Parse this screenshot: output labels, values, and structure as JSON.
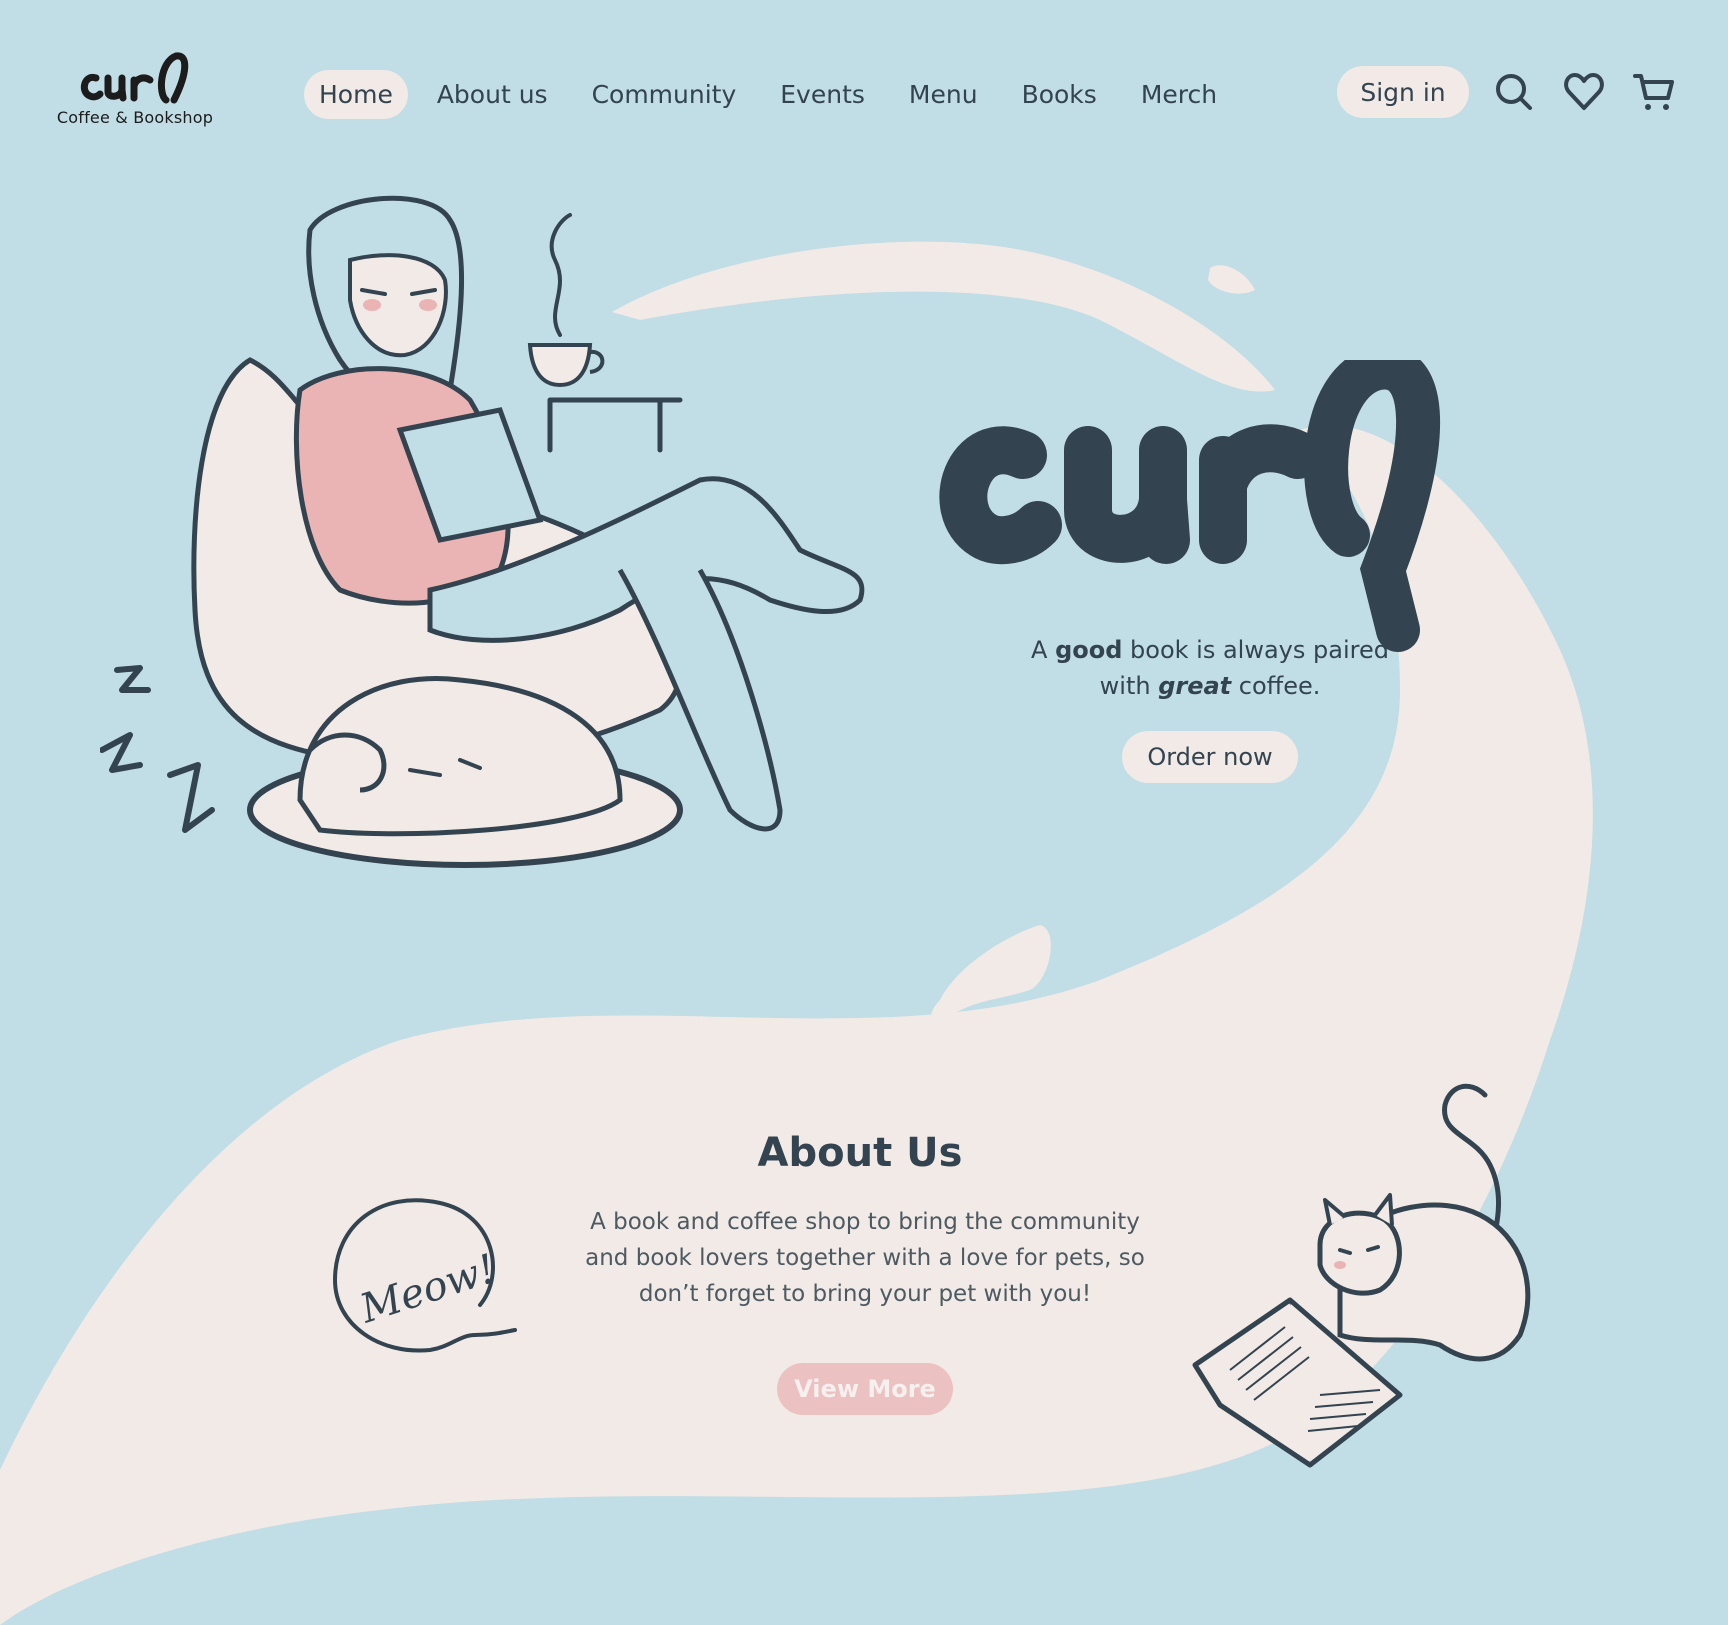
{
  "brand": {
    "name": "curl",
    "subtitle": "Coffee & Bookshop"
  },
  "nav": {
    "items": [
      {
        "label": "Home",
        "active": true
      },
      {
        "label": "About us"
      },
      {
        "label": "Community"
      },
      {
        "label": "Events"
      },
      {
        "label": "Menu"
      },
      {
        "label": "Books"
      },
      {
        "label": "Merch"
      }
    ]
  },
  "header": {
    "sign_in_label": "Sign in",
    "icons": [
      "search-icon",
      "heart-icon",
      "cart-icon"
    ]
  },
  "hero": {
    "title": "curl",
    "tagline_pre": "A ",
    "tagline_bold": "good",
    "tagline_mid": " book is always paired with ",
    "tagline_italic": "great",
    "tagline_post": " coffee.",
    "cta_label": "Order now"
  },
  "about": {
    "title": "About Us",
    "text": "A book and coffee shop to bring the community and book lovers together with a love for pets, so don’t forget to bring your pet with you!",
    "cta_label": "View More",
    "sketch_text": "Meow!"
  },
  "colors": {
    "background": "#c1dde5",
    "cream": "#f1eae6",
    "ink": "#334450",
    "pink": "#ebc1c1"
  }
}
